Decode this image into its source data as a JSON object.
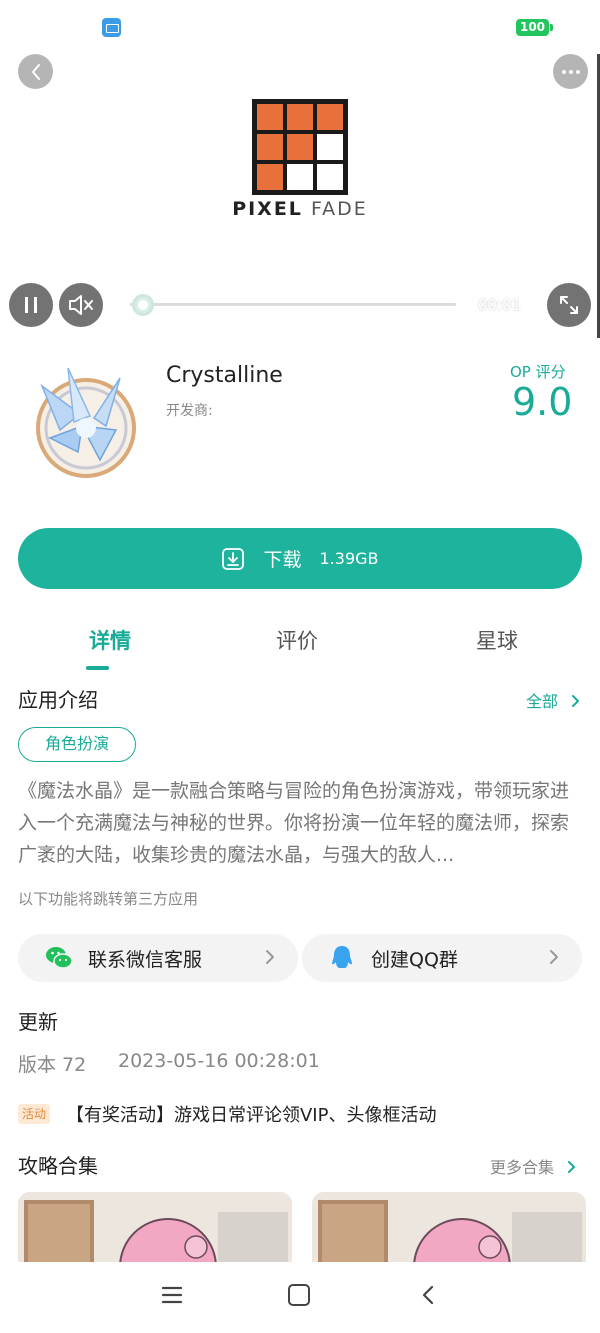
{
  "status_bar": {
    "battery": "100"
  },
  "video": {
    "logo_text_bold": "PIXEL",
    "logo_text_light": "FADE",
    "time": "00:01",
    "progress": 0.03
  },
  "app": {
    "title": "Crystalline",
    "developer_label": "开发商:",
    "score_label": "OP 评分",
    "score_value": "9.0"
  },
  "download": {
    "label": "下载",
    "size": "1.39GB"
  },
  "tabs": [
    {
      "label": "详情"
    },
    {
      "label": "评价"
    },
    {
      "label": "星球"
    }
  ],
  "intro": {
    "title": "应用介绍",
    "all_link": "全部",
    "tag": "角色扮演",
    "description": "《魔法水晶》是一款融合策略与冒险的角色扮演游戏，带领玩家进入一个充满魔法与神秘的世界。你将扮演一位年轻的魔法师，探索广袤的大陆，收集珍贵的魔法水晶，与强大的敌人...",
    "third_party_note": "以下功能将跳转第三方应用"
  },
  "actions": {
    "wechat": "联系微信客服",
    "qq": "创建QQ群"
  },
  "update": {
    "title": "更新",
    "version": "版本 72",
    "date": "2023-05-16 00:28:01",
    "event_badge": "活动",
    "event_text": "【有奖活动】游戏日常评论领VIP、头像框活动"
  },
  "guides": {
    "title": "攻略合集",
    "more": "更多合集"
  },
  "colors": {
    "accent": "#1aab98",
    "logo_orange": "#e8703a",
    "badge_bg": "#fde9d6",
    "badge_text": "#e58a3a"
  }
}
